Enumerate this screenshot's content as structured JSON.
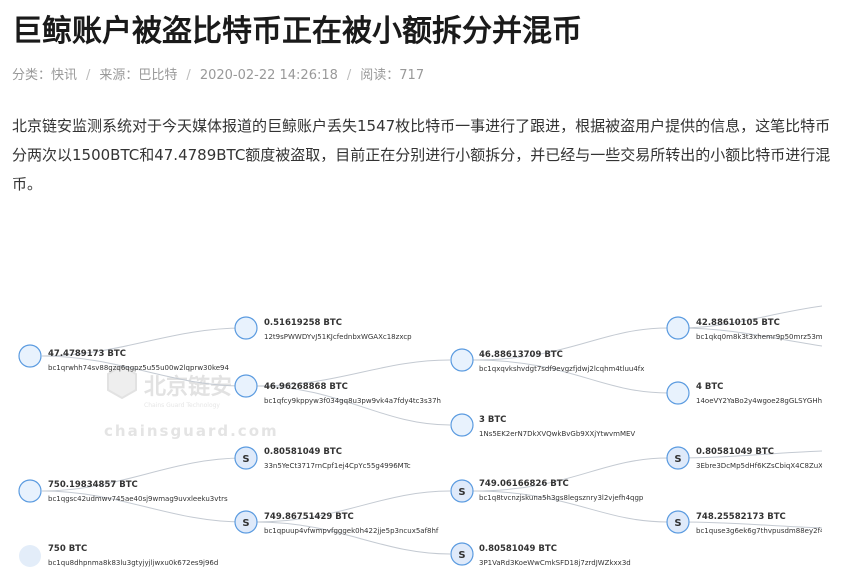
{
  "article": {
    "title": "巨鲸账户被盗比特币正在被小额拆分并混币",
    "meta": {
      "category": "分类：快讯",
      "source": "来源：巴比特",
      "datetime": "2020-02-22 14:26:18",
      "views": "阅读：717"
    },
    "body": "北京链安监测系统对于今天媒体报道的巨鲸账户丢失1547枚比特币一事进行了跟进，根据被盗用户提供的信息，这笔比特币分两次以1500BTC和47.4789BTC额度被盗取，目前正在分别进行小额拆分，并已经与一些交易所转出的小额比特币进行混币。"
  },
  "watermark": {
    "name": "北京链安",
    "sub": "Chains Guard Technology",
    "url": "chainsguard.com"
  },
  "graph": {
    "nodes": [
      {
        "id": "n1",
        "value": "47.4789173 BTC",
        "addr": "bc1qrwhh74sv88gzq6qgpz5u55u00w2lqprw30ke94",
        "s": false
      },
      {
        "id": "n2",
        "value": "0.51619258 BTC",
        "addr": "12t9sPWWDYvJ51KJcfednbxWGAXc18zxcp",
        "s": false
      },
      {
        "id": "n3",
        "value": "46.96268868 BTC",
        "addr": "bc1qfcy9kppyw3f034gq8u3pw9vk4a7fdy4tc3s37h",
        "s": false
      },
      {
        "id": "n4",
        "value": "46.88613709 BTC",
        "addr": "bc1qxqvkshvdgt7sdf9evgzfjdwj2lcqhm4tluu4fx",
        "s": false
      },
      {
        "id": "n5",
        "value": "3 BTC",
        "addr": "1Ns5EK2erN7DkXVQwkBvGb9XXjYtwvmMEV",
        "s": false
      },
      {
        "id": "n6",
        "value": "42.88610105 BTC",
        "addr": "bc1qkq0m8k3t3xhemr9p50mrz53m9",
        "s": false
      },
      {
        "id": "n7",
        "value": "4 BTC",
        "addr": "14oeVY2YaBo2y4wgoe28gGLSYGHh",
        "s": false
      },
      {
        "id": "n8",
        "value": "750.19834857 BTC",
        "addr": "bc1qgsc42udmwv745ae40sj9wmag9uvxleeku3vtrs",
        "s": false
      },
      {
        "id": "n9",
        "value": "0.80581049 BTC",
        "addr": "33n5YeCt3717rnCpf1ej4CpYc55g4996MTc",
        "s": true
      },
      {
        "id": "n10",
        "value": "749.86751429 BTC",
        "addr": "bc1qpuup4vfwmpvfgggek0h422jje5p3ncux5af8hf",
        "s": true
      },
      {
        "id": "n11",
        "value": "749.06166826 BTC",
        "addr": "bc1q8tvcnzjskuna5h3gs8legsznry3l2vjefh4qgp",
        "s": true
      },
      {
        "id": "n12",
        "value": "0.80581049 BTC",
        "addr": "3P1VaRd3KoeWwCmkSFD18j7zrdJWZkxx3d",
        "s": true
      },
      {
        "id": "n13",
        "value": "0.80581049 BTC",
        "addr": "3Ebre3DcMp5dHf6KZsCbiqX4C8ZuX",
        "s": true
      },
      {
        "id": "n14",
        "value": "748.25582173 BTC",
        "addr": "bc1quse3g6ek6g7thvpusdm88ey2f4x",
        "s": true
      },
      {
        "id": "n15",
        "value": "750 BTC",
        "addr": "bc1qu8dhpnma8k83lu3gtyjyjljwxu0k672es9j96d",
        "s": false
      }
    ],
    "s_letter": "S"
  }
}
